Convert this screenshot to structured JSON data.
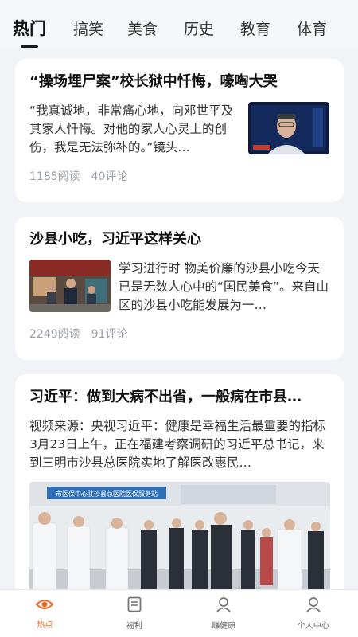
{
  "tabs": [
    "热门",
    "搞笑",
    "美食",
    "历史",
    "教育",
    "体育"
  ],
  "articles": [
    {
      "title": "“操场埋尸案”校长狱中忏悔，嚎啕大哭",
      "excerpt": "“我真诚地，非常痛心地，向邓世平及其家人忏悔。对他的家人心灵上的创伤，我是无法弥补的。”镜头…",
      "reads": "1185阅读",
      "comments": "40评论"
    },
    {
      "title": "沙县小吃，习近平这样关心",
      "excerpt": "学习进行时 物美价廉的沙县小吃今天已是无数人心中的“国民美食”。来自山区的沙县小吃能发展为一…",
      "reads": "2249阅读",
      "comments": "91评论"
    },
    {
      "title": "习近平：做到大病不出省，一般病在市县…",
      "excerpt": "视频来源：央视习近平：健康是幸福生活最重要的指标3月23日上午，正在福建考察调研的习近平总书记，来到三明市沙县总医院实地了解医改惠民…",
      "photo_sign": "市医保中心驻沙县总医院医保服务站"
    }
  ],
  "bottom_nav": [
    {
      "label": "热点",
      "icon": "eye-icon",
      "active": true
    },
    {
      "label": "福利",
      "icon": "document-icon",
      "active": false
    },
    {
      "label": "赚健康",
      "icon": "person-icon",
      "active": false
    },
    {
      "label": "个人中心",
      "icon": "person-icon",
      "active": false
    }
  ],
  "colors": {
    "accent": "#ef6a2a",
    "background": "#f1f3f7"
  }
}
